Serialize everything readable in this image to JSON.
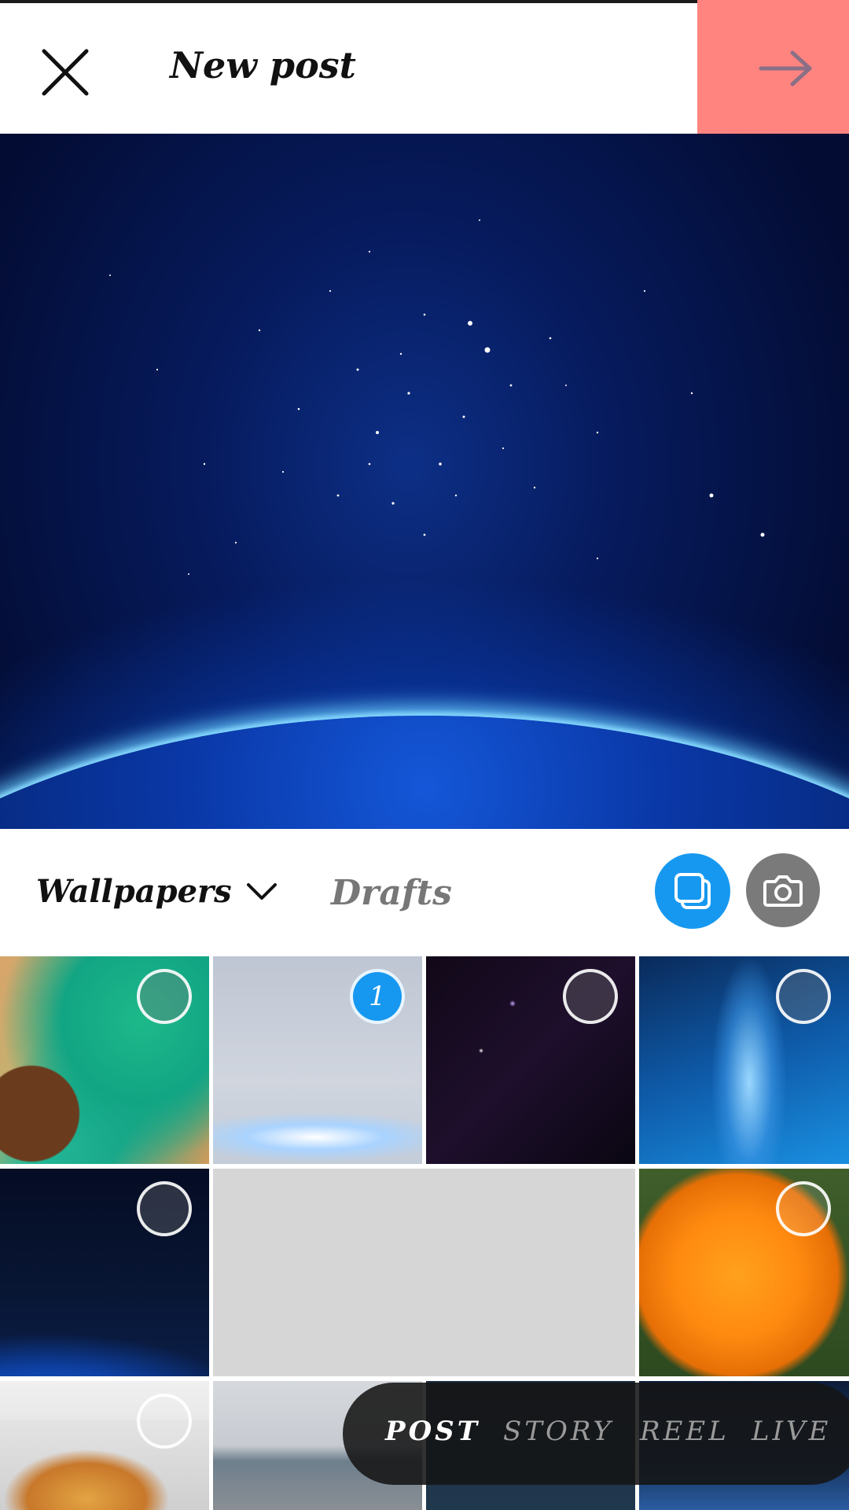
{
  "header": {
    "title": "New post",
    "close_icon": "close-icon",
    "next_icon": "arrow-right-icon",
    "highlight_color": "#ff8480"
  },
  "preview": {
    "image": "blue-earth-horizon-stars"
  },
  "controls": {
    "album_label": "Wallpapers",
    "drafts_label": "Drafts",
    "multi_select_icon": "multi-select-icon",
    "camera_icon": "camera-icon",
    "accent_color": "#1798f0"
  },
  "gallery": {
    "selected_count_label": "1",
    "tiles": [
      "green-coast-aerial",
      "light-earth-horizon",
      "purple-starfield",
      "blue-milky-way",
      "dark-earth-horizon",
      "blank-gray",
      "orange-marigold",
      "thai-temple",
      "coastal-city",
      "night-sky-dark",
      "night-sky-blue"
    ]
  },
  "modes": {
    "items": [
      "POST",
      "STORY",
      "REEL",
      "LIVE"
    ],
    "active": "POST"
  }
}
